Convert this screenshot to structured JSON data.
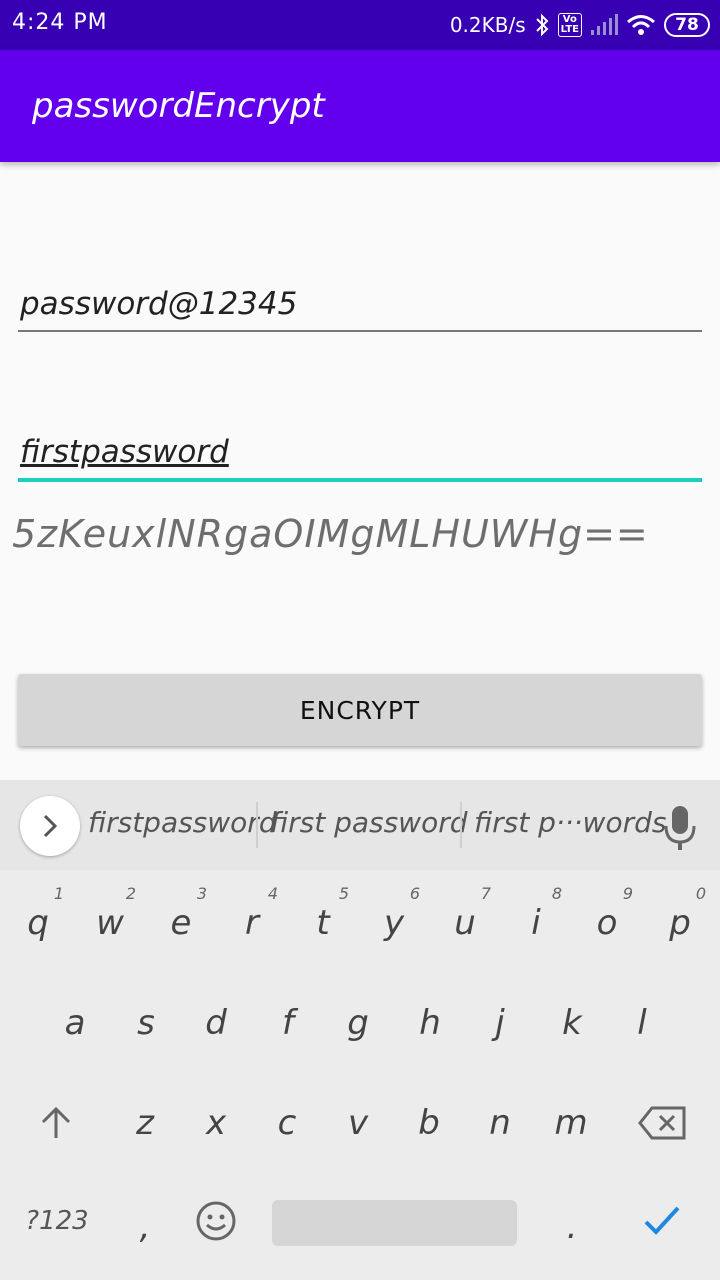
{
  "status_bar": {
    "time": "4:24 PM",
    "net_speed": "0.2KB/s",
    "volte_label": "Vo\nLTE",
    "battery": "78",
    "icons": [
      "bluetooth-icon",
      "volte-icon",
      "signal-icon",
      "wifi-icon",
      "battery-icon"
    ]
  },
  "app_bar": {
    "title": "passwordEncrypt"
  },
  "form": {
    "password_value": "password@12345",
    "key_value": "firstpassword",
    "result_text": "5zKeuxlNRgaOIMgMLHUWHg==",
    "encrypt_label": "ENCRYPT"
  },
  "keyboard": {
    "suggestions": [
      "firstpassword",
      "first password",
      "first p···words"
    ],
    "row1": [
      {
        "letter": "q",
        "num": "1"
      },
      {
        "letter": "w",
        "num": "2"
      },
      {
        "letter": "e",
        "num": "3"
      },
      {
        "letter": "r",
        "num": "4"
      },
      {
        "letter": "t",
        "num": "5"
      },
      {
        "letter": "y",
        "num": "6"
      },
      {
        "letter": "u",
        "num": "7"
      },
      {
        "letter": "i",
        "num": "8"
      },
      {
        "letter": "o",
        "num": "9"
      },
      {
        "letter": "p",
        "num": "0"
      }
    ],
    "row2": [
      "a",
      "s",
      "d",
      "f",
      "g",
      "h",
      "j",
      "k",
      "l"
    ],
    "row3": [
      "z",
      "x",
      "c",
      "v",
      "b",
      "n",
      "m"
    ],
    "symbols_label": "?123",
    "comma": ",",
    "period": "."
  },
  "colors": {
    "status_bar": "#3700b3",
    "app_bar": "#6200ee",
    "accent": "#1ccfc0",
    "done_check": "#1e88e5"
  }
}
